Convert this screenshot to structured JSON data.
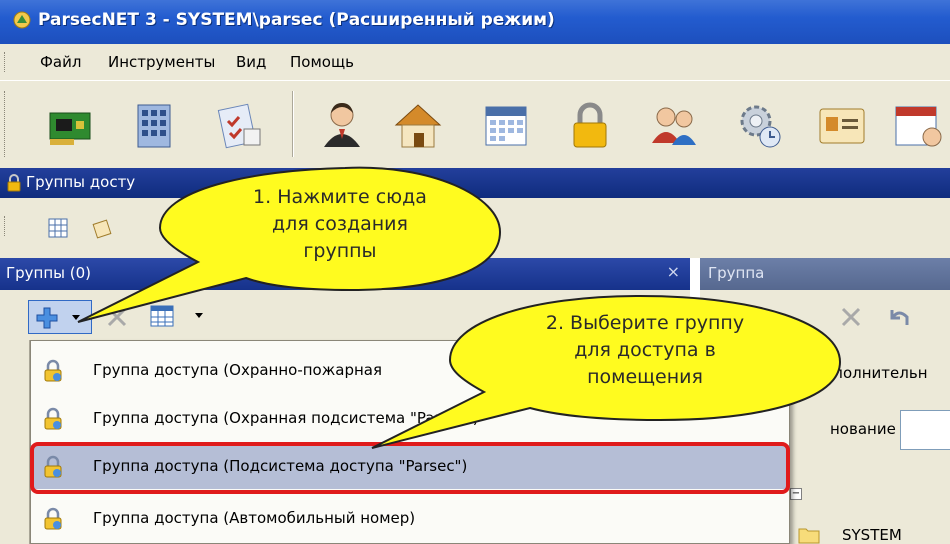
{
  "window": {
    "title": "ParsecNET 3 - SYSTEM\\parsec (Расширенный режим)"
  },
  "menu": {
    "items": [
      "Файл",
      "Инструменты",
      "Вид",
      "Помощь"
    ]
  },
  "toolbar": {
    "buttons": [
      "network-card-icon",
      "building-icon",
      "checklist-icon",
      "person-icon",
      "home-icon",
      "calendar-icon",
      "lock-icon",
      "users-icon",
      "gear-clock-icon",
      "id-card-icon",
      "schedule-icon"
    ]
  },
  "panel": {
    "title": "Группы досту"
  },
  "groups_panel": {
    "title": "Группы (0)",
    "close": "×"
  },
  "right_panel": {
    "title": "Группа",
    "extra_label": "ополнительн",
    "name_label": "нование",
    "tree_toggle": "−",
    "tree_node": "SYSTEM"
  },
  "dropdown": {
    "items": [
      {
        "label": "Группа доступа (Охранно-пожарная"
      },
      {
        "label": "Группа доступа (Охранная подсистема \"Parsec\")"
      },
      {
        "label": "Группа доступа (Подсистема доступа \"Parsec\")",
        "selected": true
      },
      {
        "label": "Группа доступа (Автомобильный номер)"
      }
    ]
  },
  "callouts": [
    {
      "lines": [
        "1. Нажмите сюда",
        "для создания",
        "группы"
      ]
    },
    {
      "lines": [
        "2. Выберите группу",
        "для доступа в",
        "помещения"
      ]
    }
  ],
  "colors": {
    "title_bar": "#235ccf",
    "panel_header": "#16328b",
    "highlight": "#e01b1b",
    "callout_fill": "#fffb1f",
    "selected_item": "#b5bed6"
  }
}
